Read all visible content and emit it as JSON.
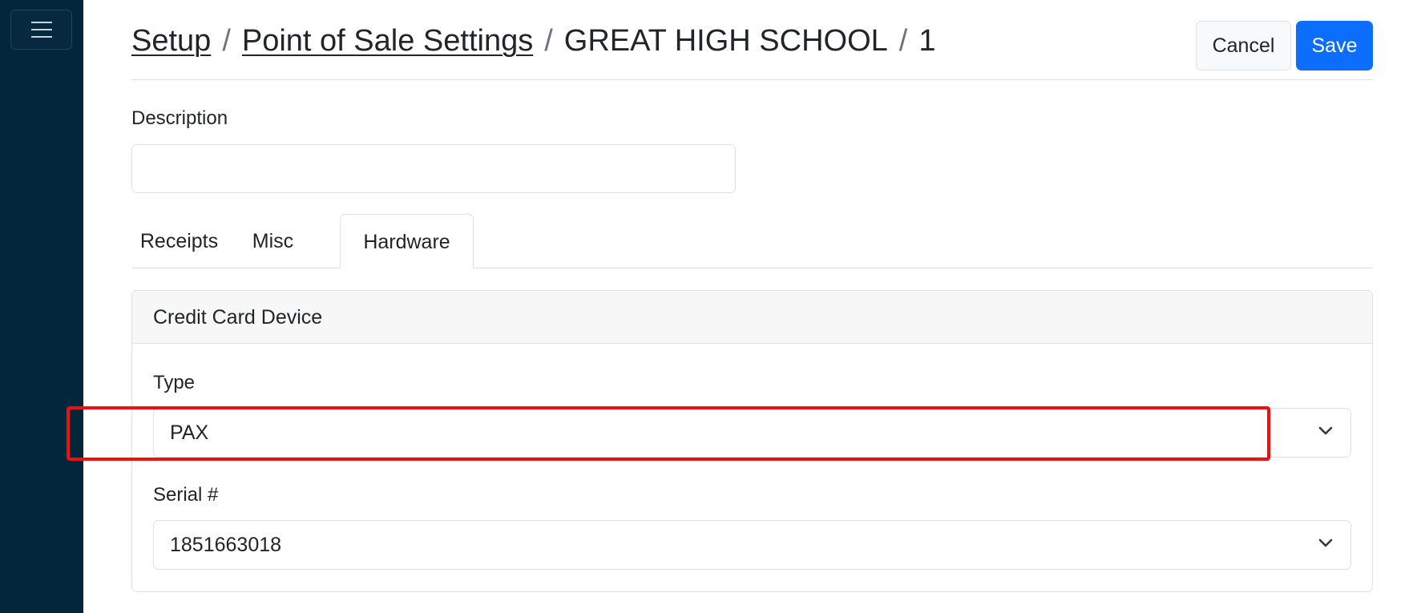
{
  "breadcrumb": {
    "setup": "Setup",
    "separator": "/",
    "pos_settings": "Point of Sale Settings",
    "school": "GREAT HIGH SCHOOL",
    "record": "1"
  },
  "actions": {
    "cancel_label": "Cancel",
    "save_label": "Save"
  },
  "description": {
    "label": "Description",
    "value": ""
  },
  "tabs": [
    {
      "label": "Receipts",
      "active": false
    },
    {
      "label": "Misc",
      "active": false
    },
    {
      "label": "Hardware",
      "active": true
    }
  ],
  "credit_card_device": {
    "title": "Credit Card Device",
    "type_label": "Type",
    "type_value": "PAX",
    "serial_label": "Serial #",
    "serial_value": "1851663018"
  },
  "icons": {
    "sidebar_toggle": "hamburger-menu-icon",
    "select_chevron": "chevron-down-icon"
  },
  "colors": {
    "sidebar": "#04263b",
    "primary": "#0d6efd",
    "highlight": "#ee0f0f"
  }
}
